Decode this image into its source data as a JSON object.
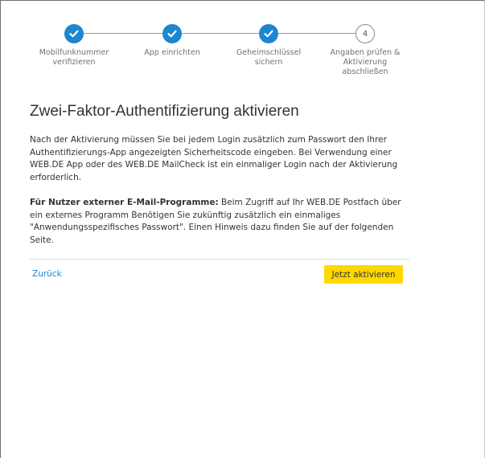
{
  "stepper": {
    "steps": [
      {
        "label": "Mobilfunknummer verifizieren",
        "status": "completed",
        "icon": "check-icon"
      },
      {
        "label": "App einrichten",
        "status": "completed",
        "icon": "check-icon"
      },
      {
        "label": "Geheimschlüssel sichern",
        "status": "completed",
        "icon": "check-icon"
      },
      {
        "label": "Angaben prüfen & Aktivierung abschließen",
        "status": "current",
        "number": "4"
      }
    ]
  },
  "page": {
    "title": "Zwei-Faktor-Authentifizierung aktivieren",
    "intro": "Nach der Aktivierung müssen Sie bei jedem Login zusätzlich zum Passwort den Ihrer Authentifizierungs-App angezeigten Sicherheitscode eingeben. Bei Verwendung einer WEB.DE App oder des WEB.DE MailCheck ist ein einmaliger Login nach der Aktivierung erforderlich.",
    "notice_heading": "Für Nutzer externer E-Mail-Programme:",
    "notice_text": " Beim Zugriff auf Ihr WEB.DE Postfach über ein externes Programm Benötigen Sie zukünftig zusätzlich ein einmaliges \"Anwendungsspezifisches Passwort\". Einen Hinweis dazu finden Sie auf der folgenden Seite."
  },
  "actions": {
    "back_label": "Zurück",
    "activate_label": "Jetzt aktivieren"
  },
  "colors": {
    "accent_blue": "#1c86d1",
    "primary_yellow": "#ffd800",
    "text": "#333333"
  }
}
